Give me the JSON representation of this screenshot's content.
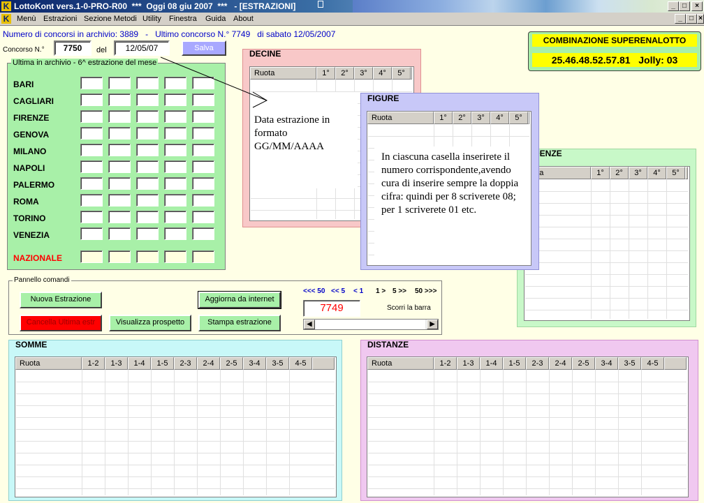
{
  "titlebar": {
    "title": "LottoKont vers.1-0-PRO-R00  ***  Oggi 08 giu 2007  ***   - [ESTRAZIONI]"
  },
  "menu": [
    "Menù",
    "Estrazioni",
    "Sezione Metodi",
    "Utility",
    "Finestra",
    "Guida",
    "About"
  ],
  "archive": {
    "text": "Numero di concorsi in archivio: 3889   -   Ultimo concorso N.° 7749   di sabato 12/05/2007"
  },
  "concorso": {
    "label": "Concorso N.°",
    "value": "7750",
    "del_label": "del",
    "date": "12/05/07",
    "save": "Salva"
  },
  "ultima": {
    "legend": "Ultima in archivio - 6^ estrazione del mese",
    "cities": [
      "BARI",
      "CAGLIARI",
      "FIRENZE",
      "GENOVA",
      "MILANO",
      "NAPOLI",
      "PALERMO",
      "ROMA",
      "TORINO",
      "VENEZIA"
    ],
    "nazionale": "NAZIONALE"
  },
  "superenalotto": {
    "title": "COMBINAZIONE SUPERENALOTTO",
    "value": "25.46.48.52.57.81   Jolly: 03"
  },
  "decine": {
    "title": "DECINE",
    "headers": [
      "Ruota",
      "1°",
      "2°",
      "3°",
      "4°",
      "5°"
    ]
  },
  "figure": {
    "title": "FIGURE",
    "headers": [
      "Ruota",
      "1°",
      "2°",
      "3°",
      "4°",
      "5°"
    ]
  },
  "cadenze": {
    "title": "DENZE",
    "headers": [
      "uota",
      "1°",
      "2°",
      "3°",
      "4°",
      "5°"
    ]
  },
  "notes": {
    "date": "Data estrazione in formato GG/MM/AAAA",
    "cells": "In ciascuna casella inserirete il numero corrispondente,avendo cura di inserire sempre la doppia cifra: quindi per 8 scriverete 08; per 1 scriverete 01 etc."
  },
  "pannello": {
    "legend": "Pannello comandi",
    "nuova": "Nuova Estrazione",
    "cancella": "Cancella Ultima estr",
    "visualizza": "Visualizza prospetto",
    "aggiorna": "Aggiorna da internet",
    "stampa": "Stampa estrazione",
    "nav": [
      "<<< 50",
      "<< 5",
      "< 1",
      "1 >",
      "5 >>",
      "50 >>>"
    ],
    "current": "7749",
    "scroll_label": "Scorri la barra"
  },
  "somme": {
    "title": "SOMME",
    "headers": [
      "Ruota",
      "1-2",
      "1-3",
      "1-4",
      "1-5",
      "2-3",
      "2-4",
      "2-5",
      "3-4",
      "3-5",
      "4-5"
    ]
  },
  "distanze": {
    "title": "DISTANZE",
    "headers": [
      "Ruota",
      "1-2",
      "1-3",
      "1-4",
      "1-5",
      "2-3",
      "2-4",
      "2-5",
      "3-4",
      "3-5",
      "4-5"
    ]
  },
  "colors": {
    "green_panel": "#a8f0a8",
    "pink_panel": "#f8c8c8",
    "lavender_panel": "#c8c8f8",
    "cyan_panel": "#c8f8f8",
    "magenta_panel": "#f0c8f0",
    "red": "#ff0000",
    "blue": "#0000c8"
  }
}
